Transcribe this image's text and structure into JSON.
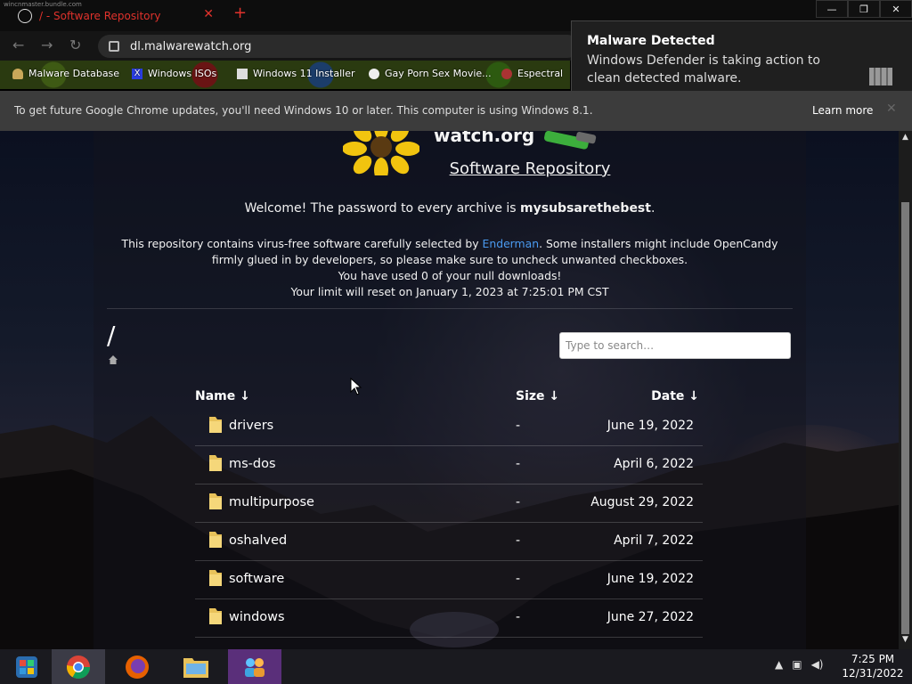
{
  "browser": {
    "tab_title": "/ - Software Repository",
    "tab_overlay_text": "wincnmaster.bundle.com",
    "url": "dl.malwarewatch.org",
    "bookmarks": [
      {
        "label": "Malware Database"
      },
      {
        "label": "Windows ISOs"
      },
      {
        "label": "Windows 11 Installer"
      },
      {
        "label": "Gay Porn Sex Movie..."
      },
      {
        "label": "Espectral"
      }
    ],
    "infobar": {
      "message": "To get future Google Chrome updates, you'll need Windows 10 or later. This computer is using Windows 8.1.",
      "learn_more": "Learn more"
    }
  },
  "notification": {
    "title": "Malware Detected",
    "body": "Windows Defender is taking action to clean detected malware."
  },
  "page": {
    "brand": "watch.org",
    "title": "Software Repository",
    "welcome_prefix": "Welcome! The password to every archive is ",
    "password": "mysubsarethebest",
    "welcome_suffix": ".",
    "desc_1": "This repository contains virus-free software carefully selected by ",
    "desc_link": "Enderman",
    "desc_2": ". Some installers might include OpenCandy firmly glued in by developers, so please make sure to uncheck unwanted checkboxes.",
    "downloads": "You have used 0 of your null downloads!",
    "reset": "Your limit will reset on January 1, 2023 at 7:25:01 PM CST",
    "breadcrumb": "/",
    "search_placeholder": "Type to search…",
    "columns": {
      "name": "Name ↓",
      "size": "Size ↓",
      "date": "Date ↓"
    },
    "rows": [
      {
        "name": "drivers",
        "size": "-",
        "date": "June 19, 2022"
      },
      {
        "name": "ms-dos",
        "size": "-",
        "date": "April 6, 2022"
      },
      {
        "name": "multipurpose",
        "size": "-",
        "date": "August 29, 2022"
      },
      {
        "name": "oshalved",
        "size": "-",
        "date": "April 7, 2022"
      },
      {
        "name": "software",
        "size": "-",
        "date": "June 19, 2022"
      },
      {
        "name": "windows",
        "size": "-",
        "date": "June 27, 2022"
      }
    ]
  },
  "taskbar": {
    "time": "7:25 PM",
    "date": "12/31/2022"
  },
  "colors": {
    "accent_link": "#4a9af0",
    "tab_red": "#e0322c",
    "notification_bg": "#1f1f1f"
  }
}
